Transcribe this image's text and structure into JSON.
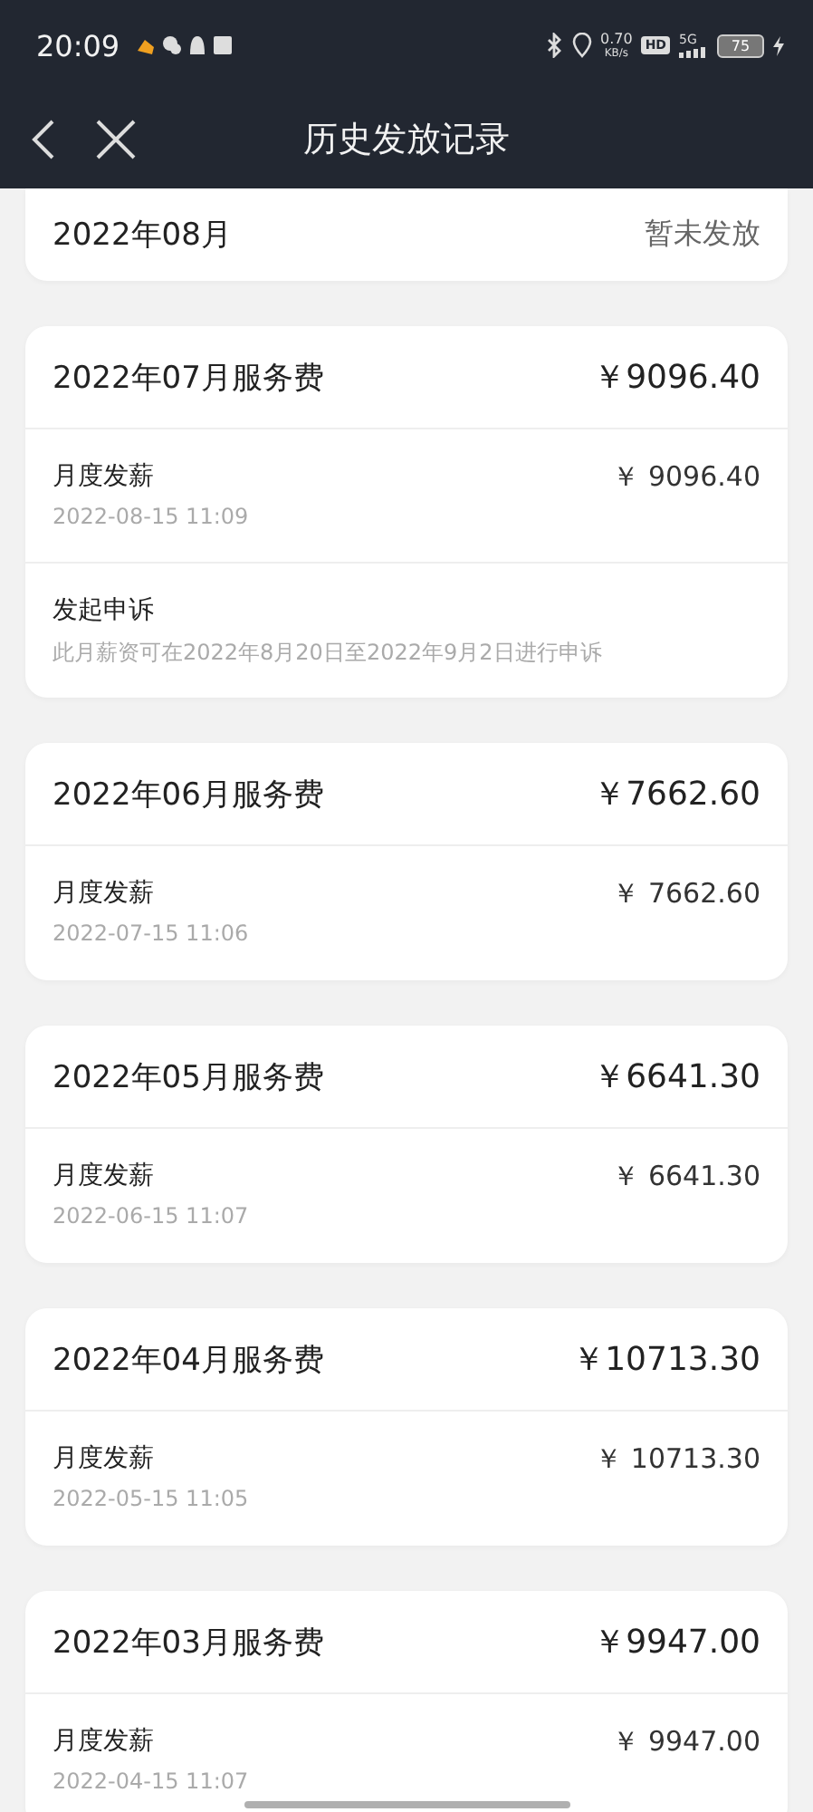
{
  "status_bar": {
    "time": "20:09",
    "speed_value": "0.70",
    "speed_unit": "KB/s",
    "hd": "HD",
    "network": "5G",
    "battery": "75"
  },
  "nav": {
    "title": "历史发放记录"
  },
  "records": [
    {
      "title": "2022年08月",
      "value": "暂未发放",
      "kind": "pending"
    },
    {
      "title": "2022年07月服务费",
      "value": "￥9096.40",
      "kind": "paid",
      "rows": [
        {
          "kind": "payment",
          "label": "月度发薪",
          "date": "2022-08-15 11:09",
          "amount": "￥ 9096.40"
        },
        {
          "kind": "appeal",
          "label": "发起申诉",
          "note": "此月薪资可在2022年8月20日至2022年9月2日进行申诉"
        }
      ]
    },
    {
      "title": "2022年06月服务费",
      "value": "￥7662.60",
      "kind": "paid",
      "rows": [
        {
          "kind": "payment",
          "label": "月度发薪",
          "date": "2022-07-15 11:06",
          "amount": "￥ 7662.60"
        }
      ]
    },
    {
      "title": "2022年05月服务费",
      "value": "￥6641.30",
      "kind": "paid",
      "rows": [
        {
          "kind": "payment",
          "label": "月度发薪",
          "date": "2022-06-15 11:07",
          "amount": "￥ 6641.30"
        }
      ]
    },
    {
      "title": "2022年04月服务费",
      "value": "￥10713.30",
      "kind": "paid",
      "rows": [
        {
          "kind": "payment",
          "label": "月度发薪",
          "date": "2022-05-15 11:05",
          "amount": "￥ 10713.30"
        }
      ]
    },
    {
      "title": "2022年03月服务费",
      "value": "￥9947.00",
      "kind": "paid",
      "rows": [
        {
          "kind": "payment",
          "label": "月度发薪",
          "date": "2022-04-15 11:07",
          "amount": "￥ 9947.00"
        }
      ]
    }
  ]
}
